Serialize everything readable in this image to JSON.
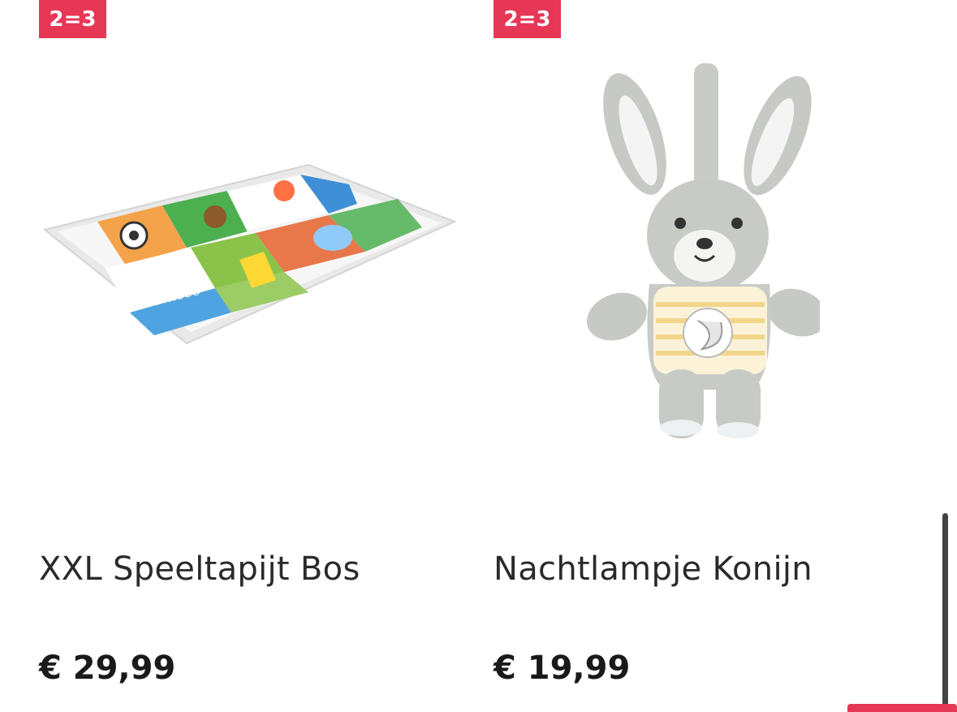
{
  "products": [
    {
      "badge": "2=3",
      "title": "XXL Speeltapijt Bos",
      "price": "€ 29,99",
      "image_icon": "play-mat-image"
    },
    {
      "badge": "2=3",
      "title": "Nachtlampje Konijn",
      "price": "€ 19,99",
      "image_icon": "bunny-nightlight-image"
    }
  ],
  "colors": {
    "badge": "#e63757",
    "text": "#222222"
  }
}
